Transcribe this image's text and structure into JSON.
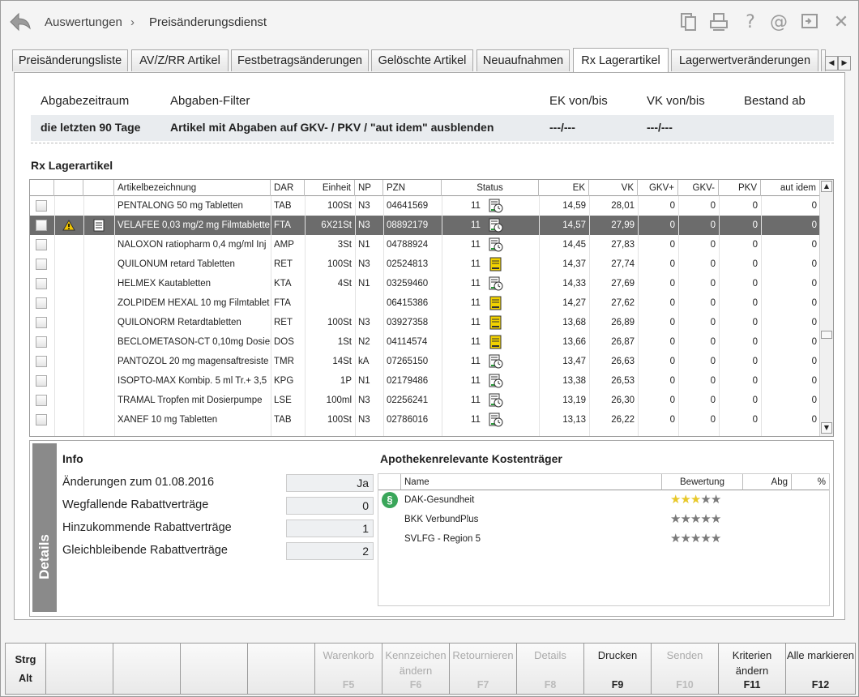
{
  "breadcrumb": {
    "first": "Auswertungen",
    "separator": "›",
    "second": "Preisänderungsdienst"
  },
  "tabs": [
    {
      "label": "Preisänderungsliste",
      "active": false
    },
    {
      "label": "AV/Z/RR Artikel",
      "active": false
    },
    {
      "label": "Festbetragsänderungen",
      "active": false
    },
    {
      "label": "Gelöschte Artikel",
      "active": false
    },
    {
      "label": "Neuaufnahmen",
      "active": false
    },
    {
      "label": "Rx Lagerartikel",
      "active": true
    },
    {
      "label": "Lagerwertveränderungen",
      "active": false
    }
  ],
  "filter": {
    "headers": {
      "zeitraum": "Abgabezeitraum",
      "filter": "Abgaben-Filter",
      "ek": "EK von/bis",
      "vk": "VK von/bis",
      "bestand": "Bestand ab"
    },
    "values": {
      "zeitraum": "die letzten 90 Tage",
      "filter": "Artikel mit Abgaben auf GKV- / PKV / \"aut idem\" ausblenden",
      "ek": "---/---",
      "vk": "---/---",
      "bestand": ""
    }
  },
  "section_title": "Rx Lagerartikel",
  "table": {
    "columns": {
      "name": "Artikelbezeichnung",
      "dar": "DAR",
      "einheit": "Einheit",
      "np": "NP",
      "pzn": "PZN",
      "status": "Status",
      "ek": "EK",
      "vk": "VK",
      "gkvp": "GKV+",
      "gkvm": "GKV-",
      "pkv": "PKV",
      "autidem": "aut idem"
    },
    "rows": [
      {
        "name": "PENTALONG 50 mg Tabletten",
        "dar": "TAB",
        "einheit": "100St",
        "np": "N3",
        "pzn": "04641569",
        "status_num": "11",
        "status_icon": "clock",
        "ek": "14,59",
        "vk": "28,01",
        "gkvp": "0",
        "gkvm": "0",
        "pkv": "0",
        "autidem": "0"
      },
      {
        "name": "VELAFEE 0,03 mg/2 mg Filmtablette",
        "dar": "FTA",
        "einheit": "6X21St",
        "np": "N3",
        "pzn": "08892179",
        "status_num": "11",
        "status_icon": "clock",
        "ek": "14,57",
        "vk": "27,99",
        "gkvp": "0",
        "gkvm": "0",
        "pkv": "0",
        "autidem": "0"
      },
      {
        "name": "NALOXON ratiopharm 0,4 mg/ml Inj",
        "dar": "AMP",
        "einheit": "3St",
        "np": "N1",
        "pzn": "04788924",
        "status_num": "11",
        "status_icon": "clock",
        "ek": "14,45",
        "vk": "27,83",
        "gkvp": "0",
        "gkvm": "0",
        "pkv": "0",
        "autidem": "0"
      },
      {
        "name": "QUILONUM retard Tabletten",
        "dar": "RET",
        "einheit": "100St",
        "np": "N3",
        "pzn": "02524813",
        "status_num": "11",
        "status_icon": "yellow",
        "ek": "14,37",
        "vk": "27,74",
        "gkvp": "0",
        "gkvm": "0",
        "pkv": "0",
        "autidem": "0"
      },
      {
        "name": "HELMEX Kautabletten",
        "dar": "KTA",
        "einheit": "4St",
        "np": "N1",
        "pzn": "03259460",
        "status_num": "11",
        "status_icon": "clock",
        "ek": "14,33",
        "vk": "27,69",
        "gkvp": "0",
        "gkvm": "0",
        "pkv": "0",
        "autidem": "0"
      },
      {
        "name": "ZOLPIDEM HEXAL 10 mg Filmtablet",
        "dar": "FTA",
        "einheit": "",
        "np": "",
        "pzn": "06415386",
        "status_num": "11",
        "status_icon": "yellow",
        "ek": "14,27",
        "vk": "27,62",
        "gkvp": "0",
        "gkvm": "0",
        "pkv": "0",
        "autidem": "0"
      },
      {
        "name": "QUILONORM Retardtabletten",
        "dar": "RET",
        "einheit": "100St",
        "np": "N3",
        "pzn": "03927358",
        "status_num": "11",
        "status_icon": "yellow",
        "ek": "13,68",
        "vk": "26,89",
        "gkvp": "0",
        "gkvm": "0",
        "pkv": "0",
        "autidem": "0"
      },
      {
        "name": "BECLOMETASON-CT 0,10mg Dosier",
        "dar": "DOS",
        "einheit": "1St",
        "np": "N2",
        "pzn": "04114574",
        "status_num": "11",
        "status_icon": "yellow",
        "ek": "13,66",
        "vk": "26,87",
        "gkvp": "0",
        "gkvm": "0",
        "pkv": "0",
        "autidem": "0"
      },
      {
        "name": "PANTOZOL 20 mg magensaftresiste",
        "dar": "TMR",
        "einheit": "14St",
        "np": "kA",
        "pzn": "07265150",
        "status_num": "11",
        "status_icon": "clock",
        "ek": "13,47",
        "vk": "26,63",
        "gkvp": "0",
        "gkvm": "0",
        "pkv": "0",
        "autidem": "0"
      },
      {
        "name": "ISOPTO-MAX Kombip. 5 ml Tr.+ 3,5",
        "dar": "KPG",
        "einheit": "1P",
        "np": "N1",
        "pzn": "02179486",
        "status_num": "11",
        "status_icon": "clock",
        "ek": "13,38",
        "vk": "26,53",
        "gkvp": "0",
        "gkvm": "0",
        "pkv": "0",
        "autidem": "0"
      },
      {
        "name": "TRAMAL Tropfen mit Dosierpumpe",
        "dar": "LSE",
        "einheit": "100ml",
        "np": "N3",
        "pzn": "02256241",
        "status_num": "11",
        "status_icon": "clock",
        "ek": "13,19",
        "vk": "26,30",
        "gkvp": "0",
        "gkvm": "0",
        "pkv": "0",
        "autidem": "0"
      },
      {
        "name": "XANEF 10 mg Tabletten",
        "dar": "TAB",
        "einheit": "100St",
        "np": "N3",
        "pzn": "02786016",
        "status_num": "11",
        "status_icon": "clock",
        "ek": "13,13",
        "vk": "26,22",
        "gkvp": "0",
        "gkvm": "0",
        "pkv": "0",
        "autidem": "0"
      }
    ]
  },
  "details": {
    "tab_label": "Details",
    "info_title": "Info",
    "info_rows": [
      {
        "label": "Änderungen zum 01.08.2016",
        "value": "Ja"
      },
      {
        "label": "Wegfallende Rabattverträge",
        "value": "0"
      },
      {
        "label": "Hinzukommende Rabattverträge",
        "value": "1"
      },
      {
        "label": "Gleichbleibende Rabattverträge",
        "value": "2"
      }
    ],
    "kt_title": "Apothekenrelevante Kostenträger",
    "kt_columns": {
      "name": "Name",
      "bewertung": "Bewertung",
      "abg": "Abg",
      "pct": "%"
    },
    "kt_rows": [
      {
        "name": "DAK-Gesundheit",
        "stars": 3,
        "icon": "paragraph-icon"
      },
      {
        "name": "BKK VerbundPlus",
        "stars": 0,
        "icon": ""
      },
      {
        "name": "SVLFG - Region 5",
        "stars": 0,
        "icon": ""
      }
    ],
    "paragraph_symbol": "§"
  },
  "fkeys": [
    {
      "label": "Strg",
      "key": "Alt",
      "enabled": true
    },
    {
      "label": "",
      "key": "",
      "enabled": true
    },
    {
      "label": "",
      "key": "",
      "enabled": true
    },
    {
      "label": "",
      "key": "",
      "enabled": true
    },
    {
      "label": "",
      "key": "",
      "enabled": true
    },
    {
      "label": "Warenkorb",
      "key": "F5",
      "enabled": false
    },
    {
      "label": "Kennzeichen ändern",
      "key": "F6",
      "enabled": false
    },
    {
      "label": "Retournieren",
      "key": "F7",
      "enabled": false
    },
    {
      "label": "Details",
      "key": "F8",
      "enabled": false
    },
    {
      "label": "Drucken",
      "key": "F9",
      "enabled": true
    },
    {
      "label": "Senden",
      "key": "F10",
      "enabled": false
    },
    {
      "label": "Kriterien ändern",
      "key": "F11",
      "enabled": true
    },
    {
      "label": "Alle markieren",
      "key": "F12",
      "enabled": true
    }
  ],
  "colors": {
    "selected_row": "#6c6c6c",
    "star_on": "#e8c82a",
    "star_off": "#7a7a7a",
    "status_yellow": "#f2d200",
    "paragraph_green": "#3aa65a"
  }
}
